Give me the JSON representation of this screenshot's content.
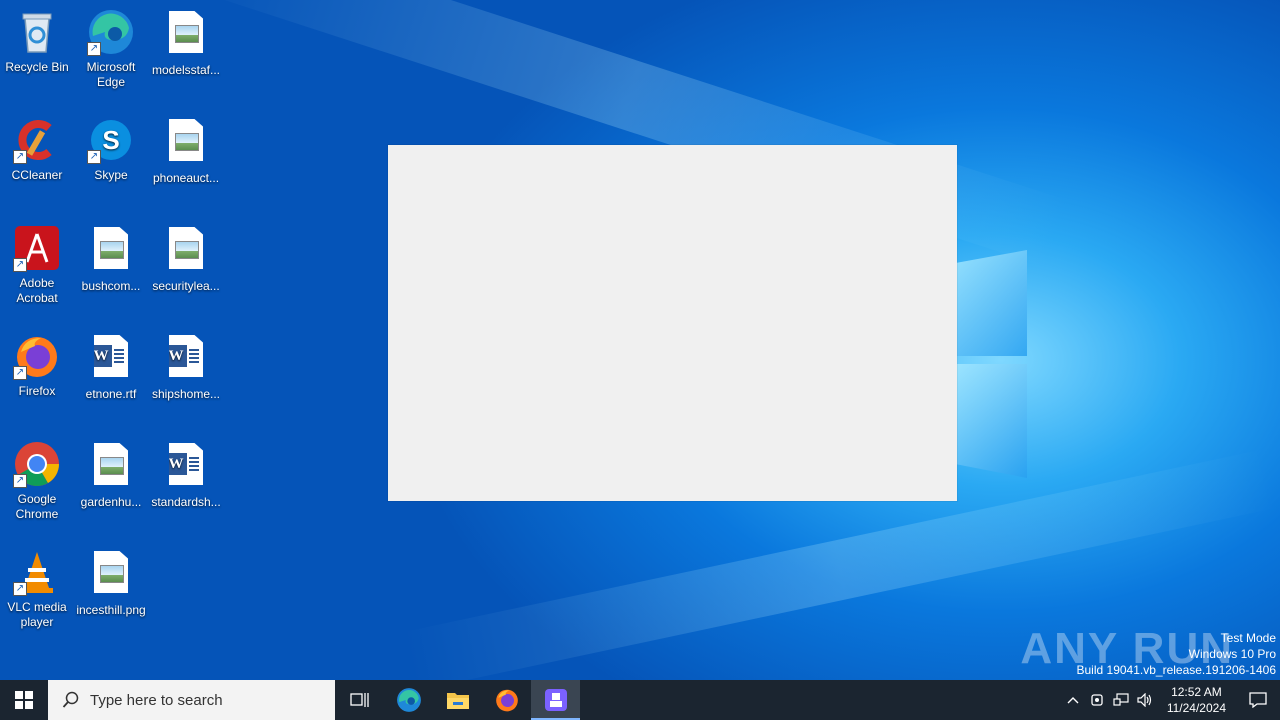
{
  "desktop": {
    "icons": [
      {
        "label": "Recycle Bin",
        "icon": "recycle-bin-icon"
      },
      {
        "label": "Microsoft Edge",
        "icon": "edge-icon"
      },
      {
        "label": "modelsstaf...",
        "icon": "image-file-icon"
      },
      {
        "label": "CCleaner",
        "icon": "ccleaner-icon"
      },
      {
        "label": "Skype",
        "icon": "skype-icon"
      },
      {
        "label": "phoneauct...",
        "icon": "image-file-icon"
      },
      {
        "label": "Adobe Acrobat",
        "icon": "acrobat-icon"
      },
      {
        "label": "bushcom...",
        "icon": "image-file-icon"
      },
      {
        "label": "securitylea...",
        "icon": "image-file-icon"
      },
      {
        "label": "Firefox",
        "icon": "firefox-icon"
      },
      {
        "label": "etnone.rtf",
        "icon": "word-doc-icon"
      },
      {
        "label": "shipshome...",
        "icon": "word-doc-icon"
      },
      {
        "label": "Google Chrome",
        "icon": "chrome-icon"
      },
      {
        "label": "gardenhu...",
        "icon": "image-file-icon"
      },
      {
        "label": "standardsh...",
        "icon": "word-doc-icon"
      },
      {
        "label": "VLC media player",
        "icon": "vlc-icon"
      },
      {
        "label": "incesthill.png",
        "icon": "image-file-icon"
      }
    ]
  },
  "watermark": {
    "brand": "ANY RUN",
    "line1": "Test Mode",
    "line2": "Windows 10 Pro",
    "line3": "Build 19041.vb_release.191206-1406"
  },
  "taskbar": {
    "search_placeholder": "Type here to search",
    "time": "12:52 AM",
    "date": "11/24/2024"
  },
  "colors": {
    "taskbar": "#1b2530",
    "dialog": "#f0f0f0",
    "accent": "#0a78dd"
  }
}
